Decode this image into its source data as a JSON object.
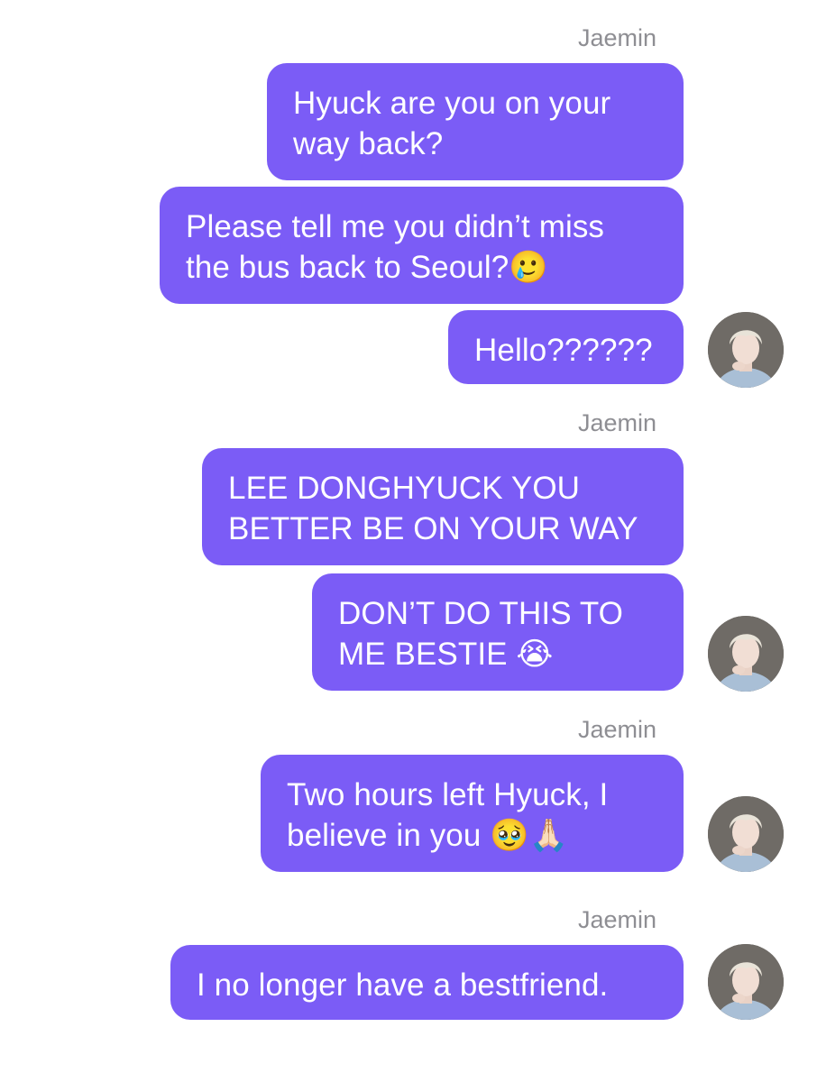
{
  "conversation": {
    "groups": [
      {
        "sender": "Jaemin",
        "messages": [
          "Hyuck are you on your\nway back?",
          "Please tell me you didn’t miss\nthe bus back to Seoul?🥲",
          "Hello??????"
        ]
      },
      {
        "sender": "Jaemin",
        "messages": [
          "LEE DONGHYUCK YOU\nBETTER BE ON YOUR WAY",
          "DON’T DO THIS TO\nME BESTIE 😭"
        ]
      },
      {
        "sender": "Jaemin",
        "messages": [
          "Two hours left Hyuck, I\nbelieve in you 🥹🙏🏻"
        ]
      },
      {
        "sender": "Jaemin",
        "messages": [
          "I no longer have a bestfriend."
        ]
      }
    ]
  },
  "theme": {
    "bubble_color": "#7b5cf6",
    "bubble_text_color": "#ffffff",
    "sender_label_color": "#8e8e93",
    "background": "#ffffff"
  },
  "icons": {
    "avatar": "profile-photo-avatar"
  }
}
